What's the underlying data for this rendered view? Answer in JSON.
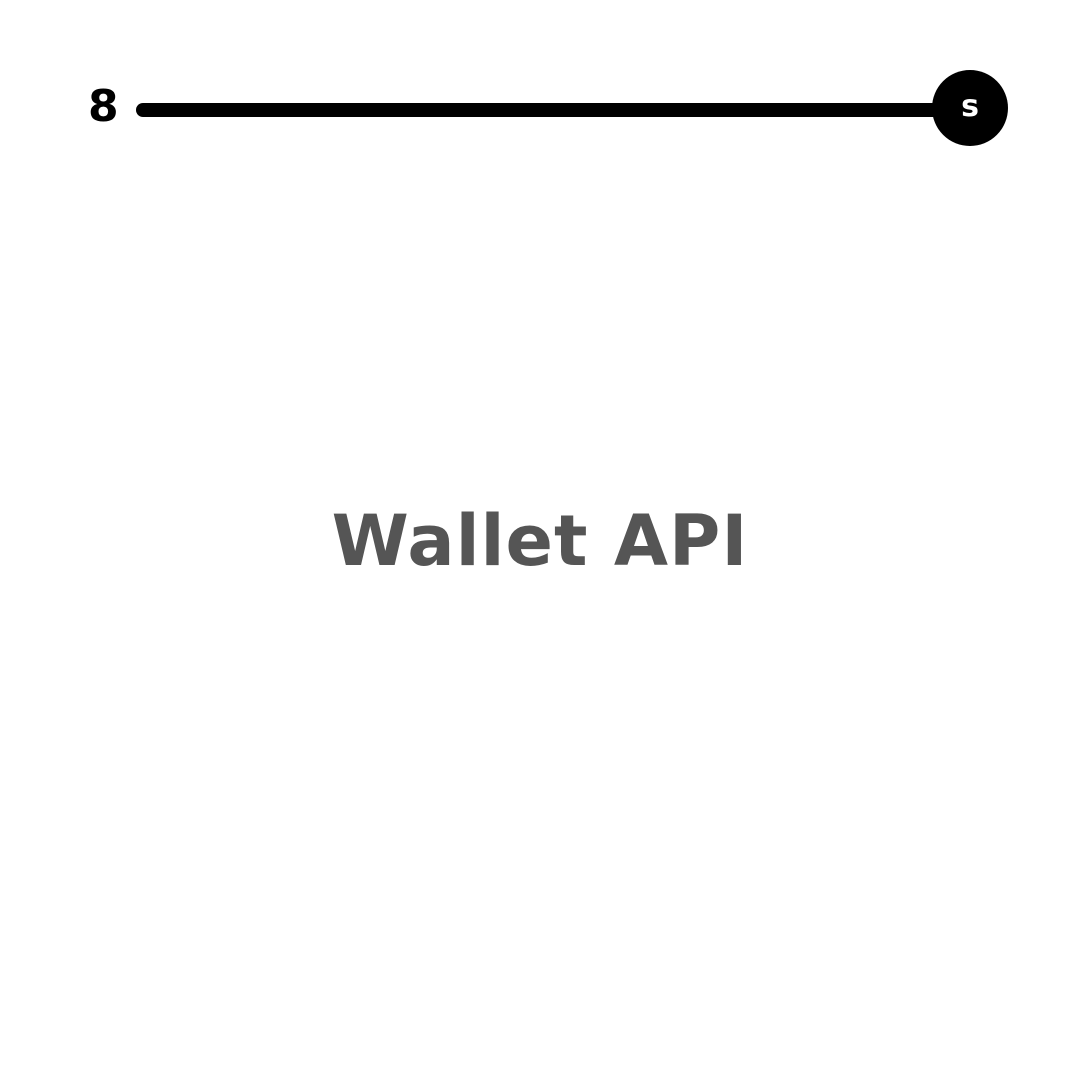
{
  "header": {
    "slide_number": "8",
    "badge_letter": "s"
  },
  "main": {
    "title": "Wallet API"
  },
  "colors": {
    "background": "#ffffff",
    "track": "#000000",
    "badge": "#000000",
    "title": "#555555"
  }
}
